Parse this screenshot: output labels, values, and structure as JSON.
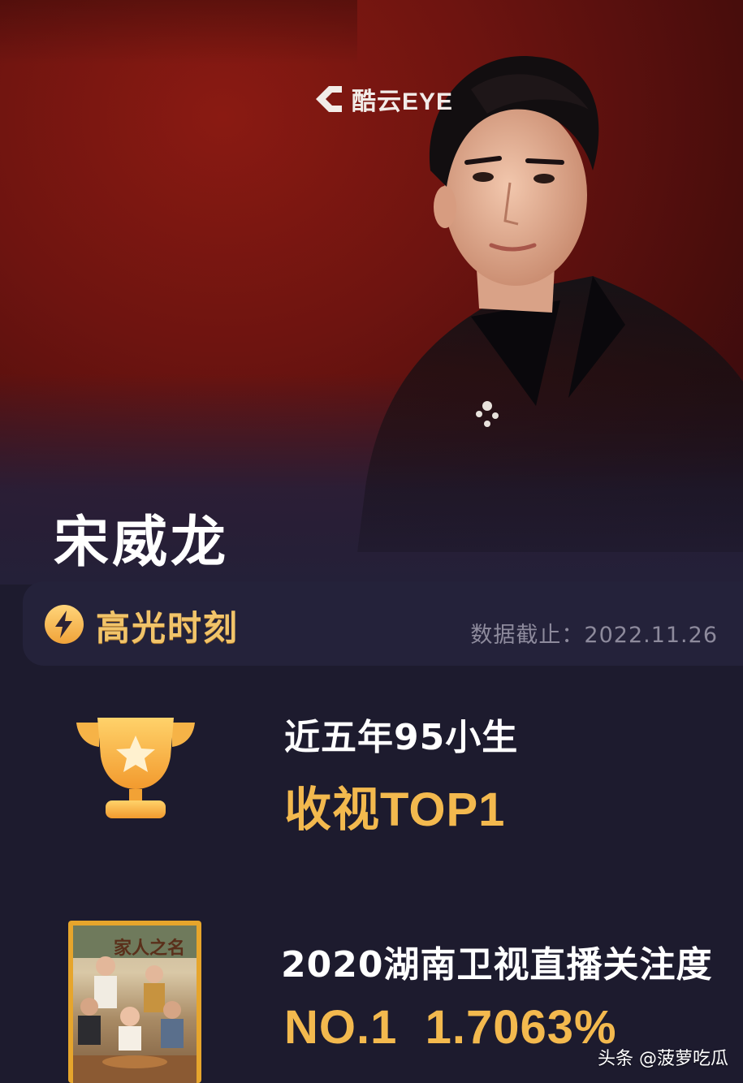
{
  "hero": {
    "logo_text": "酷云EYE",
    "star_name": "宋威龙"
  },
  "highlight": {
    "title": "高光时刻",
    "date_label": "数据截止：2022.11.26",
    "icon": "bolt-icon"
  },
  "achievements": [
    {
      "icon": "trophy-icon",
      "title": "近五年95小生",
      "value": "收视TOP1"
    },
    {
      "icon": "poster-image",
      "poster_title": "家人之名",
      "title": "2020湖南卫视直播关注度",
      "value": "NO.1  1.7063%"
    }
  ],
  "watermark": {
    "text": "头条 @菠萝吃瓜"
  },
  "colors": {
    "accent_gold": "#f3b94e",
    "card_bg": "#24223a",
    "page_bg": "#1d1b2e",
    "hero_red": "#6e1410"
  }
}
